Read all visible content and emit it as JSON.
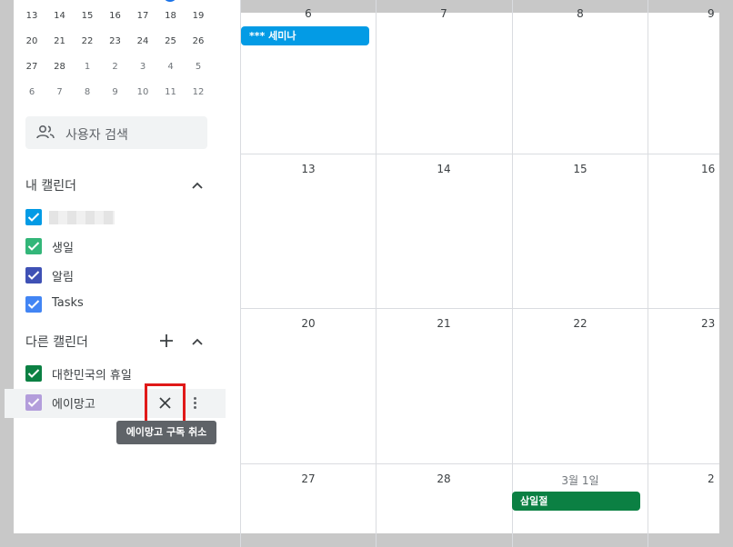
{
  "mini_calendar": {
    "rows": [
      [
        {
          "d": "13"
        },
        {
          "d": "14"
        },
        {
          "d": "15"
        },
        {
          "d": "16"
        },
        {
          "d": "17"
        },
        {
          "d": "18"
        },
        {
          "d": "19"
        }
      ],
      [
        {
          "d": "20"
        },
        {
          "d": "21"
        },
        {
          "d": "22"
        },
        {
          "d": "23"
        },
        {
          "d": "24"
        },
        {
          "d": "25"
        },
        {
          "d": "26"
        }
      ],
      [
        {
          "d": "27"
        },
        {
          "d": "28"
        },
        {
          "d": "1",
          "dim": true
        },
        {
          "d": "2",
          "dim": true
        },
        {
          "d": "3",
          "dim": true
        },
        {
          "d": "4",
          "dim": true
        },
        {
          "d": "5",
          "dim": true
        }
      ],
      [
        {
          "d": "6",
          "dim": true
        },
        {
          "d": "7",
          "dim": true
        },
        {
          "d": "8",
          "dim": true
        },
        {
          "d": "9",
          "dim": true
        },
        {
          "d": "10",
          "dim": true
        },
        {
          "d": "11",
          "dim": true
        },
        {
          "d": "12",
          "dim": true
        }
      ]
    ]
  },
  "search": {
    "label": "사용자 검색",
    "icon": "people-icon"
  },
  "my_calendars": {
    "title": "내 캘린더",
    "items": [
      {
        "name": "",
        "color": "#039be5",
        "blurred": true
      },
      {
        "name": "생일",
        "color": "#33b679"
      },
      {
        "name": "알림",
        "color": "#3f51b5"
      },
      {
        "name": "Tasks",
        "color": "#4285f4"
      }
    ]
  },
  "other_calendars": {
    "title": "다른 캘린더",
    "items": [
      {
        "name": "대한민국의 휴일",
        "color": "#0b8043"
      },
      {
        "name": "에이망고",
        "color": "#b39ddb"
      }
    ],
    "unsubscribe_tooltip": "에이망고 구독 취소"
  },
  "month_grid": {
    "weeks": [
      [
        "6",
        "7",
        "8",
        "9"
      ],
      [
        "13",
        "14",
        "15",
        "16"
      ],
      [
        "20",
        "21",
        "22",
        "23"
      ],
      [
        "27",
        "28",
        "3월 1일",
        "2"
      ]
    ],
    "events": [
      {
        "title": "*** 세미나",
        "color": "#039be5"
      },
      {
        "title": "삼일절",
        "color": "#0b8043"
      }
    ]
  }
}
